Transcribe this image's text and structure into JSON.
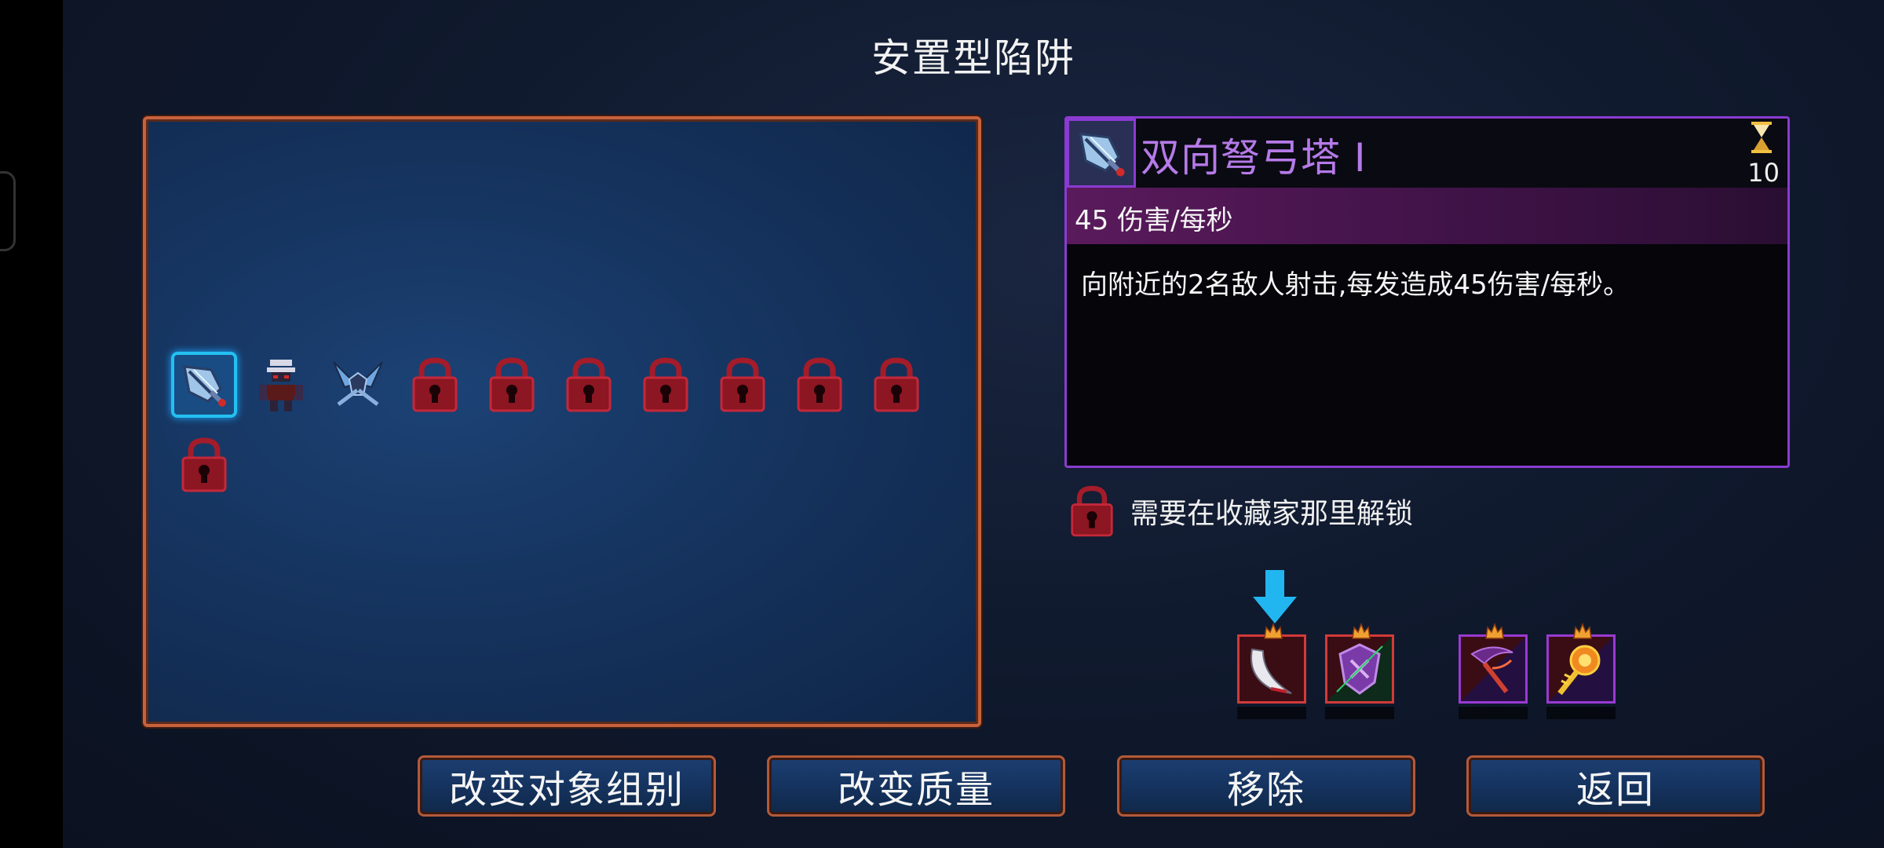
{
  "screen": {
    "title": "安置型陷阱"
  },
  "grid": {
    "slots": [
      {
        "id": "dual-crossbow",
        "icon": "crossbow-turret-icon",
        "state": "selected"
      },
      {
        "id": "ninja",
        "icon": "ninja-trap-icon",
        "state": "unlocked"
      },
      {
        "id": "wings",
        "icon": "wing-blades-icon",
        "state": "unlocked"
      },
      {
        "id": "locked-1",
        "icon": "lock-icon",
        "state": "locked"
      },
      {
        "id": "locked-2",
        "icon": "lock-icon",
        "state": "locked"
      },
      {
        "id": "locked-3",
        "icon": "lock-icon",
        "state": "locked"
      },
      {
        "id": "locked-4",
        "icon": "lock-icon",
        "state": "locked"
      },
      {
        "id": "locked-5",
        "icon": "lock-icon",
        "state": "locked"
      },
      {
        "id": "locked-6",
        "icon": "lock-icon",
        "state": "locked"
      },
      {
        "id": "locked-7",
        "icon": "lock-icon",
        "state": "locked"
      },
      {
        "id": "locked-8",
        "icon": "lock-icon",
        "state": "locked"
      }
    ]
  },
  "detail": {
    "name": "双向弩弓塔 I",
    "cost": "10",
    "stat": "45 伤害/每秒",
    "description": "向附近的2名敌人射击,每发造成45伤害/每秒。",
    "accent_color": "#8b3bd1"
  },
  "unlock_note": {
    "text": "需要在收藏家那里解锁"
  },
  "mutations": [
    {
      "icon": "blade-icon",
      "border": "#d23a3a",
      "selected": true
    },
    {
      "icon": "shield-tentacle-icon",
      "border": "#d23a3a",
      "selected": false
    },
    {
      "icon": "scythe-icon",
      "border": "#9a3ad2",
      "selected": false
    },
    {
      "icon": "fire-burst-icon",
      "border": "#9a3ad2",
      "selected": false
    }
  ],
  "buttons": {
    "change_group": "改变对象组别",
    "change_quality": "改变质量",
    "remove": "移除",
    "back": "返回"
  }
}
